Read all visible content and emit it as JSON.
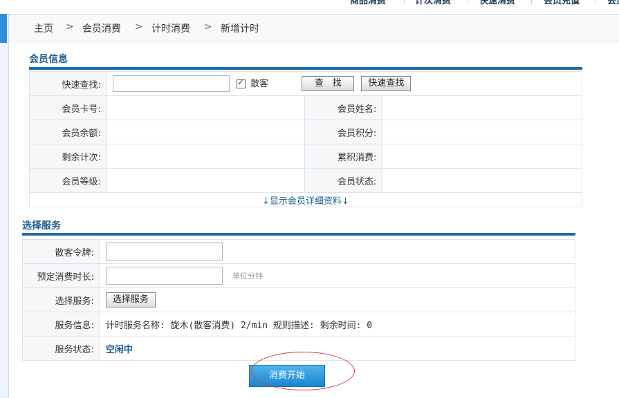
{
  "top_nav": [
    "商品消费",
    "计次消费",
    "快速消费",
    "会员充值",
    "会员"
  ],
  "breadcrumb": [
    "主页",
    "会员消费",
    "计时消费",
    "新增计时"
  ],
  "breadcrumb_sep": ">",
  "member_info": {
    "title": "会员信息",
    "quick_search_label": "快速查找:",
    "quick_search_value": "",
    "guest_checkbox_label": "散客",
    "guest_checked": true,
    "search_button": "查　找",
    "quick_search_button": "快速查找",
    "fields": [
      [
        "会员卡号:",
        "",
        "会员姓名:",
        ""
      ],
      [
        "会员余额:",
        "",
        "会员积分:",
        ""
      ],
      [
        "剩余计次:",
        "",
        "累积消费:",
        ""
      ],
      [
        "会员等级:",
        "",
        "会员状态:",
        ""
      ]
    ],
    "show_detail_link": "↓显示会员详细资料↓"
  },
  "service": {
    "title": "选择服务",
    "token_label": "散客令牌:",
    "token_value": "",
    "duration_label": "预定消费时长:",
    "duration_value": "",
    "duration_hint": "单位分钟",
    "select_label": "选择服务:",
    "select_button": "选择服务",
    "info_label": "服务信息:",
    "info_text": "计时服务名称: 旋木(散客消费) 2/min 规则描述:  剩余时间: 0",
    "status_label": "服务状态:",
    "status_value": "空闲中"
  },
  "start_button": "消费开始",
  "colors": {
    "accent": "#1f6aa8",
    "button_blue": "#1a86cf",
    "highlight_ring": "#d23c3c"
  }
}
